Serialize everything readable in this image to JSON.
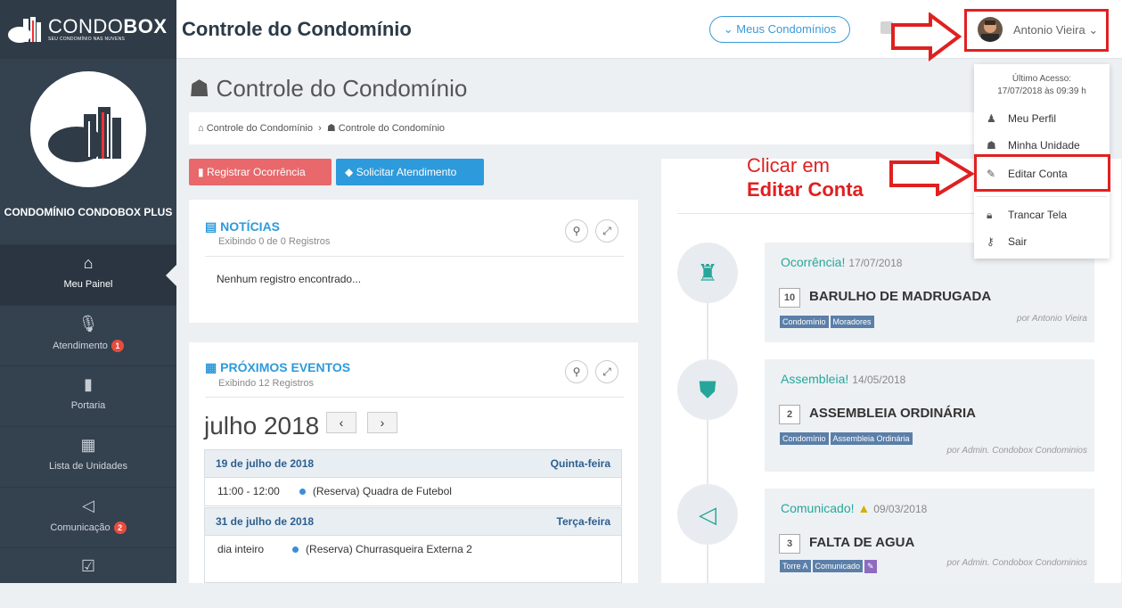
{
  "brand": {
    "name_light": "CONDO",
    "name_bold": "BOX",
    "slogan": "SEU CONDOMÍNIO NAS NUVENS"
  },
  "sidebar": {
    "condo_name": "CONDOMÍNIO CONDOBOX PLUS",
    "items": [
      {
        "label": "Meu Painel",
        "icon": "home-icon",
        "badge": ""
      },
      {
        "label": "Atendimento",
        "icon": "microphone-icon",
        "badge": "1"
      },
      {
        "label": "Portaria",
        "icon": "door-icon",
        "badge": ""
      },
      {
        "label": "Lista de Unidades",
        "icon": "building-icon",
        "badge": ""
      },
      {
        "label": "Comunicação",
        "icon": "megaphone-icon",
        "badge": "2"
      },
      {
        "label": "",
        "icon": "calendar-check-icon",
        "badge": ""
      }
    ]
  },
  "header": {
    "title": "Controle do Condomínio",
    "condos_button": "Meus Condomínios",
    "user_name": "Antonio Vieira"
  },
  "dropdown": {
    "last_access_label": "Último Acesso:",
    "last_access_value": "17/07/2018 às 09:39 h",
    "items": [
      "Meu Perfil",
      "Minha Unidade",
      "Editar Conta",
      "Trancar Tela",
      "Sair"
    ]
  },
  "annotation": {
    "line1": "Clicar em",
    "line2": "Editar Conta"
  },
  "page": {
    "title": "Controle do Condomínio",
    "breadcrumb": [
      "Controle do Condomínio",
      "Controle do Condomínio"
    ]
  },
  "actions": {
    "ocorrencia": "Registrar Ocorrência",
    "atendimento": "Solicitar Atendimento"
  },
  "noticias": {
    "title": "NOTÍCIAS",
    "subtitle": "Exibindo 0 de 0 Registros",
    "empty": "Nenhum registro encontrado..."
  },
  "eventos": {
    "title": "PRÓXIMOS EVENTOS",
    "subtitle": "Exibindo 12 Registros",
    "month": "julho 2018",
    "days": [
      {
        "date": "19 de julho de 2018",
        "weekday": "Quinta-feira",
        "time": "11:00 - 12:00",
        "event": "(Reserva) Quadra de Futebol"
      },
      {
        "date": "31 de julho de 2018",
        "weekday": "Terça-feira",
        "time": "dia inteiro",
        "event": "(Reserva) Churrasqueira Externa 2"
      }
    ]
  },
  "timeline": [
    {
      "type": "Ocorrência!",
      "date": "17/07/2018",
      "num": "10",
      "subject": "BARULHO DE MADRUGADA",
      "tags": [
        "Condomínio",
        "Moradores"
      ],
      "by": "por Antonio Vieira",
      "icon": "fire-extinguisher-icon"
    },
    {
      "type": "Assembleia!",
      "date": "14/05/2018",
      "num": "2",
      "subject": "ASSEMBLEIA ORDINÁRIA",
      "tags": [
        "Condomínio",
        "Assembleia Ordinária"
      ],
      "by": "por Admin. Condobox Condominios",
      "icon": "shield-icon"
    },
    {
      "type": "Comunicado!",
      "date": "09/03/2018",
      "num": "3",
      "subject": "FALTA DE AGUA",
      "tags": [
        "Torre A",
        "Comunicado"
      ],
      "by": "por Admin. Condobox Condominios",
      "icon": "megaphone-icon"
    }
  ]
}
